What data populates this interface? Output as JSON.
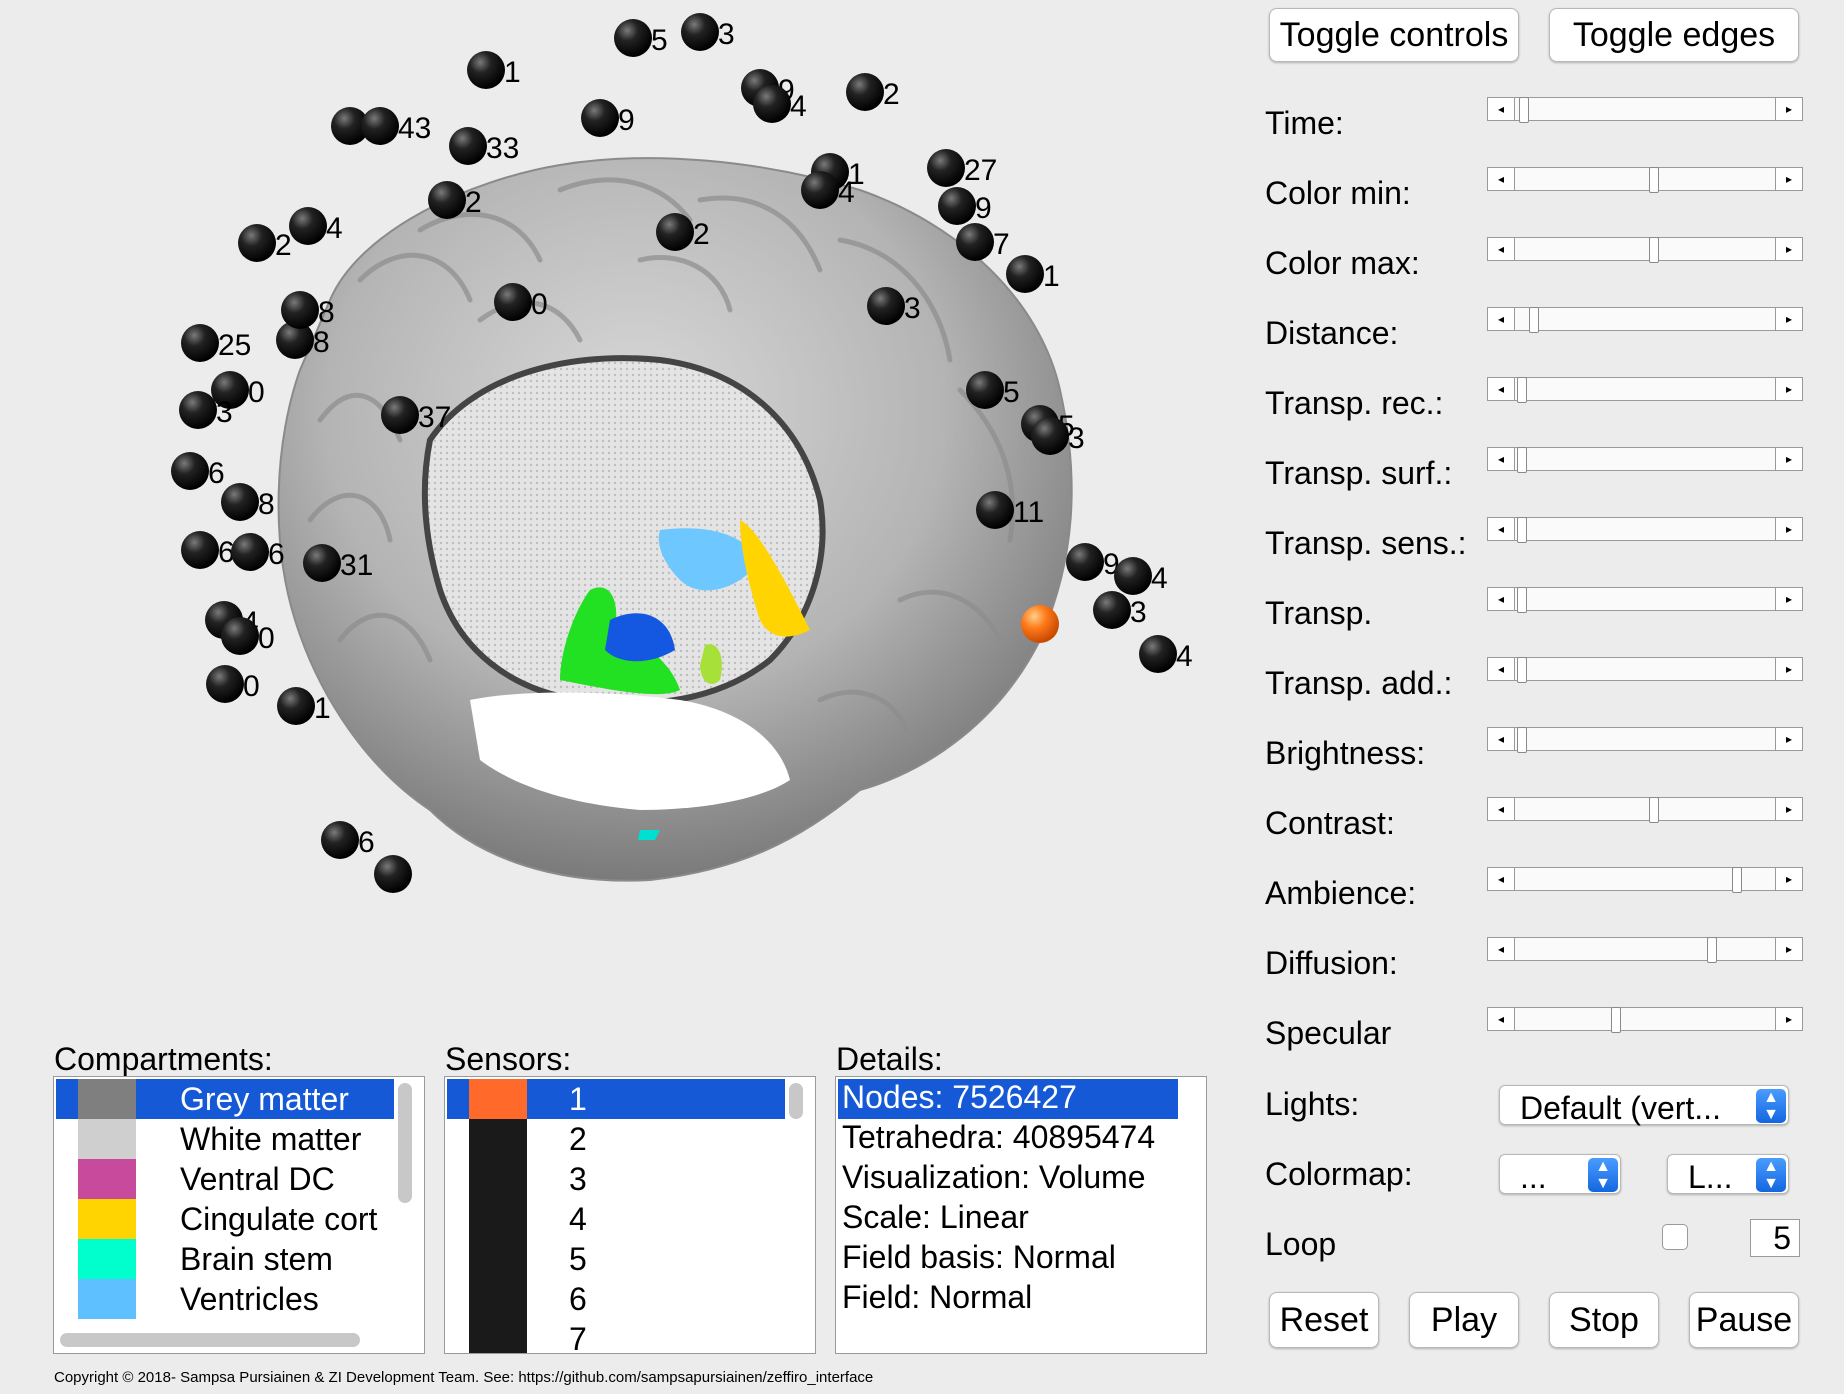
{
  "buttons": {
    "toggle_controls": "Toggle controls",
    "toggle_edges": "Toggle edges",
    "reset": "Reset",
    "play": "Play",
    "stop": "Stop",
    "pause": "Pause"
  },
  "controls": [
    {
      "label": "Time:",
      "level": 0.02
    },
    {
      "label": "Color min:",
      "level": 0.53
    },
    {
      "label": "Color max:",
      "level": 0.53
    },
    {
      "label": "Distance:",
      "level": 0.06
    },
    {
      "label": "Transp. rec.:",
      "level": 0.01
    },
    {
      "label": "Transp. surf.:",
      "level": 0.01
    },
    {
      "label": "Transp. sens.:",
      "level": 0.01
    },
    {
      "label": "Transp.",
      "level": 0.01
    },
    {
      "label": "Transp. add.:",
      "level": 0.01
    },
    {
      "label": "Brightness:",
      "level": 0.01
    },
    {
      "label": "Contrast:",
      "level": 0.53
    },
    {
      "label": "Ambience:",
      "level": 0.86
    },
    {
      "label": "Diffusion:",
      "level": 0.76
    },
    {
      "label": "Specular",
      "level": 0.38
    }
  ],
  "lights": {
    "label": "Lights:",
    "value": "Default (vert..."
  },
  "colormap": {
    "label": "Colormap:",
    "value1": "...",
    "value2": "L..."
  },
  "loop": {
    "label": "Loop",
    "checked": false,
    "value": "5"
  },
  "compartments": {
    "title": "Compartments:",
    "items": [
      {
        "label": "Grey matter",
        "color": "#7f7f7f",
        "selected": true
      },
      {
        "label": "White matter",
        "color": "#cfcfcf",
        "selected": false
      },
      {
        "label": "Ventral DC",
        "color": "#c84a9c",
        "selected": false
      },
      {
        "label": "Cingulate cort",
        "color": "#ffd400",
        "selected": false
      },
      {
        "label": "Brain stem",
        "color": "#00ffcc",
        "selected": false
      },
      {
        "label": "Ventricles",
        "color": "#5fc0ff",
        "selected": false
      }
    ]
  },
  "sensors": {
    "title": "Sensors:",
    "items": [
      {
        "label": "1",
        "color": "#ff6a2a",
        "selected": true
      },
      {
        "label": "2",
        "color": "#1a1a1a",
        "selected": false
      },
      {
        "label": "3",
        "color": "#1a1a1a",
        "selected": false
      },
      {
        "label": "4",
        "color": "#1a1a1a",
        "selected": false
      },
      {
        "label": "5",
        "color": "#1a1a1a",
        "selected": false
      },
      {
        "label": "6",
        "color": "#1a1a1a",
        "selected": false
      },
      {
        "label": "7",
        "color": "#1a1a1a",
        "selected": false
      }
    ]
  },
  "details": {
    "title": "Details:",
    "items": [
      "Nodes: 7526427",
      "Tetrahedra: 40895474",
      "Visualization: Volume",
      "Scale: Linear",
      "Field basis: Normal",
      "Field: Normal"
    ]
  },
  "electrode_labels": [
    "5",
    "3",
    "1",
    "9",
    "4",
    "2",
    "8",
    "43",
    "33",
    "9",
    "1",
    "4",
    "2",
    "4",
    "27",
    "9",
    "7",
    "2",
    "2",
    "0",
    "1",
    "3",
    "25",
    "8",
    "8",
    "5",
    "0",
    "3",
    "5",
    "3",
    "6",
    "37",
    "8",
    "11",
    "6",
    "6",
    "31",
    "9",
    "4",
    "4",
    "3",
    "0",
    "4",
    "0",
    "1",
    "6"
  ],
  "copyright": "Copyright © 2018- Sampsa Pursiainen & ZI Development Team. See: https://github.com/sampsapursiainen/zeffiro_interface"
}
